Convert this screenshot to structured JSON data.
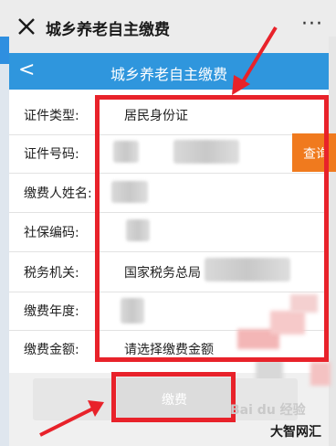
{
  "topbar": {
    "title": "城乡养老自主缴费",
    "more": "···"
  },
  "appbar": {
    "title": "城乡养老自主缴费",
    "back": "<"
  },
  "form": {
    "rows": [
      {
        "label": "证件类型:",
        "value": "居民身份证"
      },
      {
        "label": "证件号码:",
        "value": ""
      },
      {
        "label": "缴费人姓名:",
        "value": ""
      },
      {
        "label": "社保编码:",
        "value": ""
      },
      {
        "label": "税务机关:",
        "value": "国家税务总局"
      },
      {
        "label": "缴费年度:",
        "value": ""
      },
      {
        "label": "缴费金额:",
        "value": "请选择缴费金额"
      }
    ],
    "query_button": "查询",
    "pay_button": "缴费"
  },
  "watermark": {
    "text": "Bai du 经验",
    "brand": "大智网汇"
  },
  "colors": {
    "accent": "#2f96dd",
    "highlight": "#e8222a",
    "query": "#f07a1e"
  }
}
